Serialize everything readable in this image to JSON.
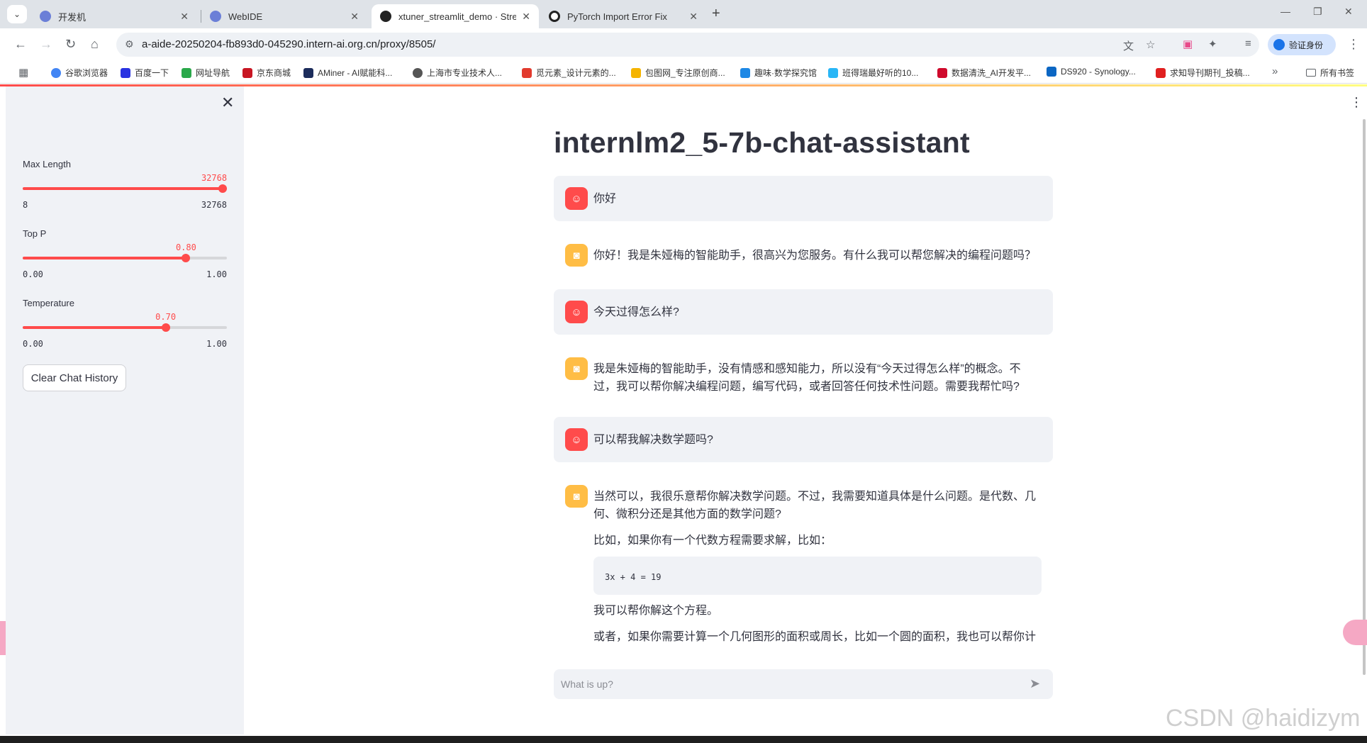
{
  "browser": {
    "tabs": [
      {
        "label": "开发机",
        "active": false
      },
      {
        "label": "WebIDE",
        "active": false
      },
      {
        "label": "xtuner_streamlit_demo · Stre",
        "active": true
      },
      {
        "label": "PyTorch Import Error Fix",
        "active": false
      }
    ],
    "url": "a-aide-20250204-fb893d0-045290.intern-ai.org.cn/proxy/8505/",
    "verify_label": "验证身份",
    "bookmarks": [
      "谷歌浏览器",
      "百度一下",
      "网址导航",
      "京东商城",
      "AMiner - AI赋能科...",
      "上海市专业技术人...",
      "觅元素_设计元素的...",
      "包图网_专注原创商...",
      "趣味·数学探究馆",
      "班得瑞最好听的10...",
      "数据清洗_AI开发平...",
      "DS920 - Synology...",
      "求知导刊期刊_投稿..."
    ],
    "all_bookmarks_label": "所有书签"
  },
  "sidebar": {
    "sliders": [
      {
        "label": "Max Length",
        "value": "32768",
        "min": "8",
        "max": "32768",
        "fraction": 1.0
      },
      {
        "label": "Top P",
        "value": "0.80",
        "min": "0.00",
        "max": "1.00",
        "fraction": 0.8
      },
      {
        "label": "Temperature",
        "value": "0.70",
        "min": "0.00",
        "max": "1.00",
        "fraction": 0.7
      }
    ],
    "clear_button": "Clear Chat History"
  },
  "main": {
    "title": "internlm2_5-7b-chat-assistant",
    "messages": [
      {
        "role": "user",
        "text": "你好"
      },
      {
        "role": "assistant",
        "text": "你好！我是朱娅梅的智能助手，很高兴为您服务。有什么我可以帮您解决的编程问题吗？"
      },
      {
        "role": "user",
        "text": "今天过得怎么样?"
      },
      {
        "role": "assistant",
        "text": "我是朱娅梅的智能助手，没有情感和感知能力，所以没有“今天过得怎么样”的概念。不过，我可以帮你解决编程问题，编写代码，或者回答任何技术性问题。需要我帮忙吗?"
      },
      {
        "role": "user",
        "text": "可以帮我解决数学题吗?"
      },
      {
        "role": "assistant",
        "text": "当然可以，我很乐意帮你解决数学问题。不过，我需要知道具体是什么问题。是代数、几何、微积分还是其他方面的数学问题?",
        "para2": "比如，如果你有一个代数方程需要求解，比如：",
        "code": "3x + 4 = 19",
        "para3": "我可以帮你解这个方程。",
        "para4": "或者，如果你需要计算一个几何图形的面积或周长，比如一个圆的面积，我也可以帮你计"
      }
    ],
    "input_placeholder": "What is up?"
  },
  "watermark": "CSDN @haidizym",
  "colors": {
    "accent": "#ff4b4b",
    "assistant_avatar": "#ffbd45",
    "sidebar_bg": "#f0f2f6",
    "text": "#31333f"
  }
}
